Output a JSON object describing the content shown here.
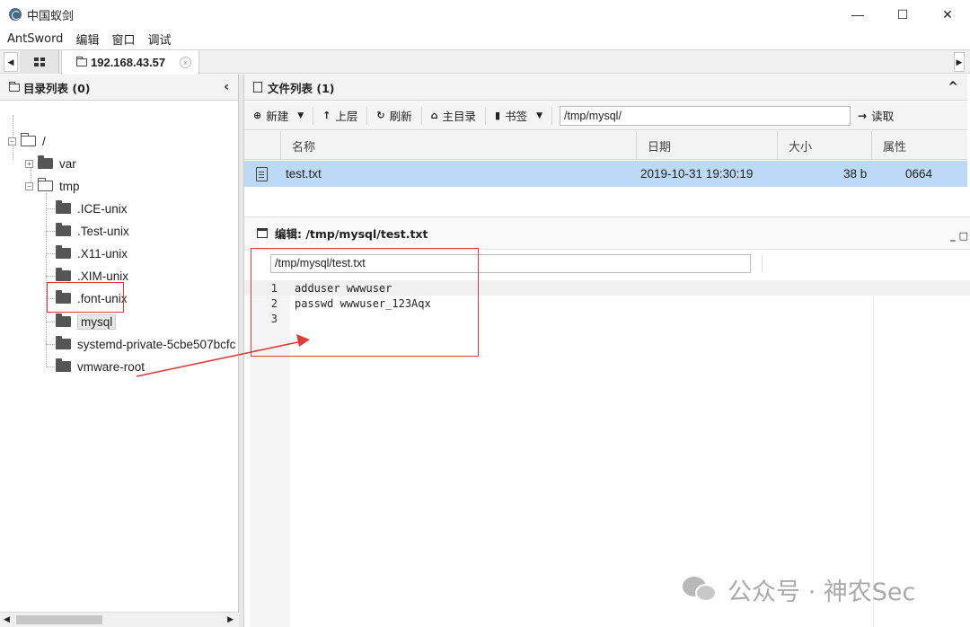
{
  "window": {
    "title": "中国蚁剑",
    "minimize": "—",
    "maximize": "☐",
    "close": "✕"
  },
  "menu": [
    "AntSword",
    "编辑",
    "窗口",
    "调试"
  ],
  "tabs": {
    "active": "192.168.43.57",
    "close": "×",
    "scroll_left": "◀",
    "scroll_right": "▶"
  },
  "left_panel": {
    "title": "目录列表 (0)",
    "collapse": "‹",
    "tree": {
      "root": "/",
      "var": "var",
      "tmp": "tmp",
      "children": [
        ".ICE-unix",
        ".Test-unix",
        ".X11-unix",
        ".XIM-unix",
        ".font-unix",
        "mysql",
        "systemd-private-5cbe507bcfc",
        "vmware-root"
      ]
    }
  },
  "file_panel": {
    "title": "文件列表 (1)",
    "collapse": "^",
    "toolbar": {
      "new": "新建",
      "up": "上层",
      "refresh": "刷新",
      "home": "主目录",
      "bookmark": "书签",
      "path": "/tmp/mysql/",
      "read": "读取"
    },
    "columns": [
      "名称",
      "日期",
      "大小",
      "属性"
    ],
    "rows": [
      {
        "name": "test.txt",
        "date": "2019-10-31 19:30:19",
        "size": "38 b",
        "perm": "0664"
      }
    ]
  },
  "editor": {
    "title": "编辑: /tmp/mysql/test.txt",
    "path": "/tmp/mysql/test.txt",
    "controls": "_ □",
    "lines": [
      {
        "n": "1",
        "text": "adduser wwwuser"
      },
      {
        "n": "2",
        "text": "passwd wwwuser_123Aqx"
      },
      {
        "n": "3",
        "text": ""
      }
    ]
  },
  "watermark": "公众号 · 神农Sec",
  "colors": {
    "selection": "#bcd9f5",
    "annotation": "#e03a3a"
  }
}
